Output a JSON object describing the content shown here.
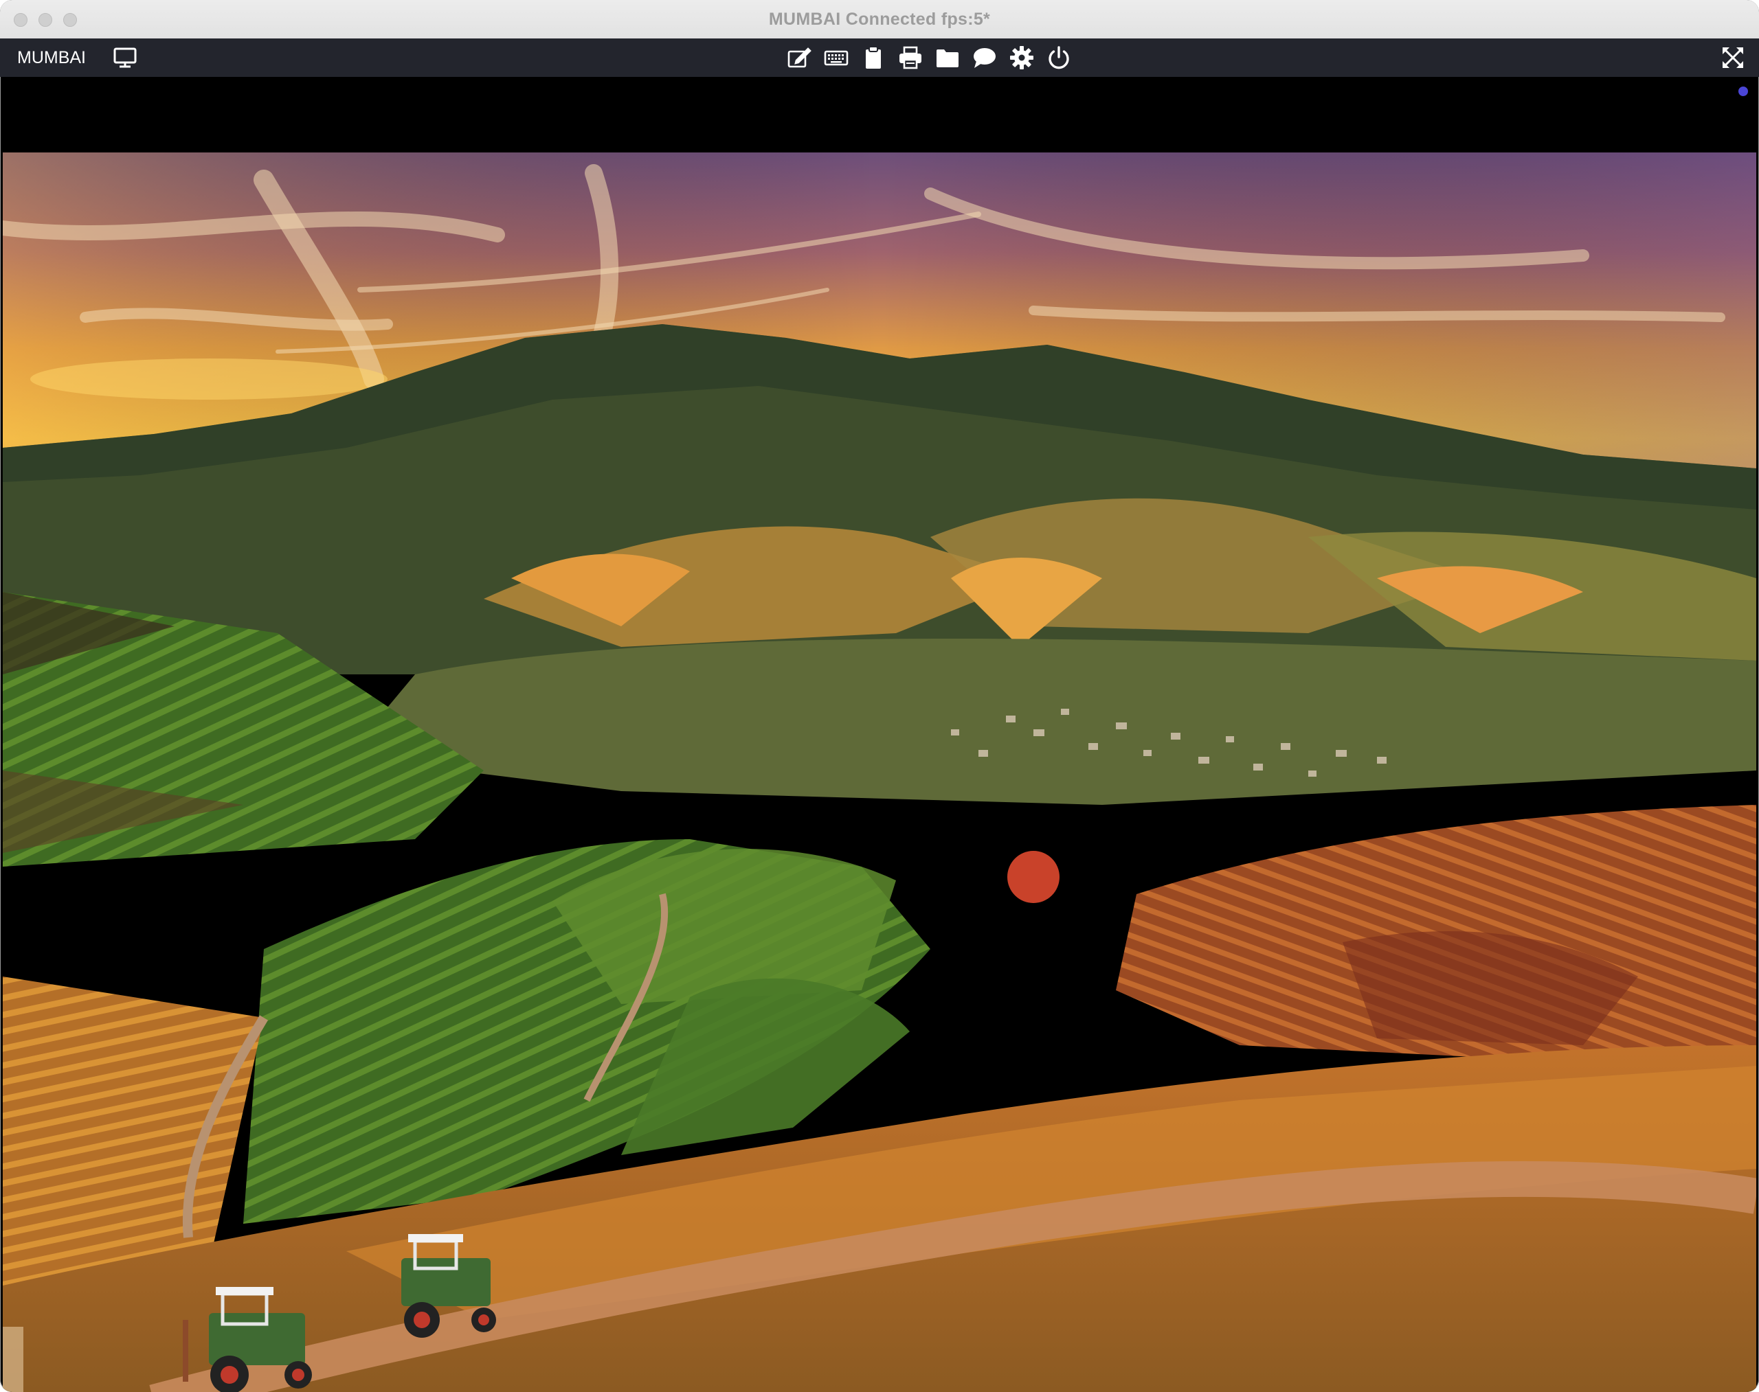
{
  "window": {
    "title": "MUMBAI Connected fps:5*"
  },
  "toolbar": {
    "host_label": "MUMBAI",
    "icons": [
      "monitor-icon",
      "edit-icon",
      "keyboard-icon",
      "clipboard-icon",
      "printer-icon",
      "folder-icon",
      "chat-icon",
      "gear-icon",
      "power-icon",
      "fullscreen-icon"
    ]
  },
  "colors": {
    "toolbar_bg": "#23252d",
    "icon": "#ffffff",
    "activity_dot": "#4b46d6"
  }
}
